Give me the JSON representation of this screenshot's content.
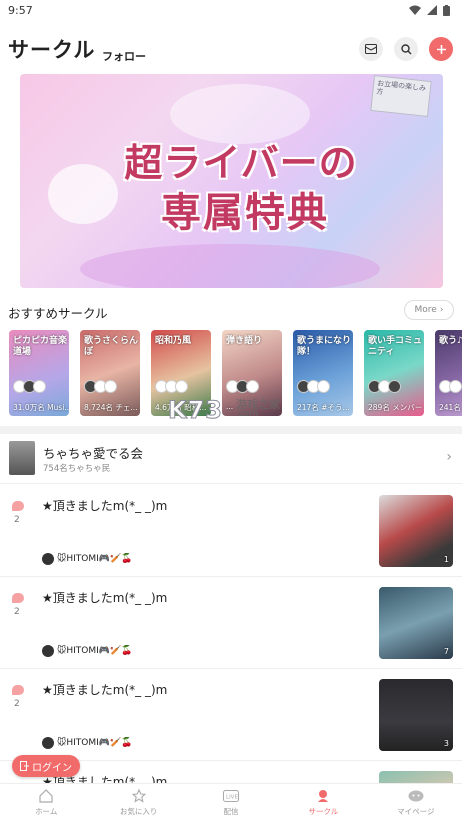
{
  "status_bar": {
    "time": "9:57"
  },
  "header": {
    "title": "サークル",
    "follow_tab": "フォロー"
  },
  "banner": {
    "line1": "超ライバーの",
    "line2": "専属特典",
    "sign_text": "お立場の楽しみ方"
  },
  "recommended": {
    "title": "おすすめサークル",
    "more_label": "More",
    "cards": [
      {
        "name": "ピカピカ音楽道場",
        "members": "31.0万名 Musi..."
      },
      {
        "name": "歌うさくらんぼ",
        "members": "8,724名 チェ..."
      },
      {
        "name": "昭和乃風",
        "members": "4.6万名 昭和..."
      },
      {
        "name": "弾き語り",
        "members": "..."
      },
      {
        "name": "歌うまになり隊！",
        "members": "217名 #そう..."
      },
      {
        "name": "歌い手コミュニティ",
        "members": "289名 メンバー"
      },
      {
        "name": "歌う♪",
        "members": "241名"
      }
    ]
  },
  "watermark": {
    "text": "K73",
    "sub": "游戏之家",
    "domain": ".com"
  },
  "circle": {
    "name": "ちゃちゃ愛でる会",
    "members": "754名ちゃちゃ民"
  },
  "posts": [
    {
      "comments": "2",
      "title": "★頂きましたm(*_ _)m",
      "author": "🐭HITOMI🎮🏏🍒",
      "image_count": "1"
    },
    {
      "comments": "2",
      "title": "★頂きましたm(*_ _)m",
      "author": "🐭HITOMI🎮🏏🍒",
      "image_count": "7"
    },
    {
      "comments": "2",
      "title": "★頂きましたm(*_ _)m",
      "author": "🐭HITOMI🎮🏏🍒",
      "image_count": "3"
    },
    {
      "comments": "",
      "title": "★頂きましたm(*_ _)m",
      "author": "",
      "image_count": ""
    }
  ],
  "login_button": "ログイン",
  "tabs": [
    {
      "label": "ホーム",
      "icon": "home-icon"
    },
    {
      "label": "お気に入り",
      "icon": "star-icon"
    },
    {
      "label": "配信",
      "icon": "live-icon"
    },
    {
      "label": "サークル",
      "icon": "circle-icon",
      "active": true
    },
    {
      "label": "マイページ",
      "icon": "profile-icon"
    }
  ],
  "colors": {
    "accent": "#f26b6b",
    "banner_text": "#c23a62"
  }
}
